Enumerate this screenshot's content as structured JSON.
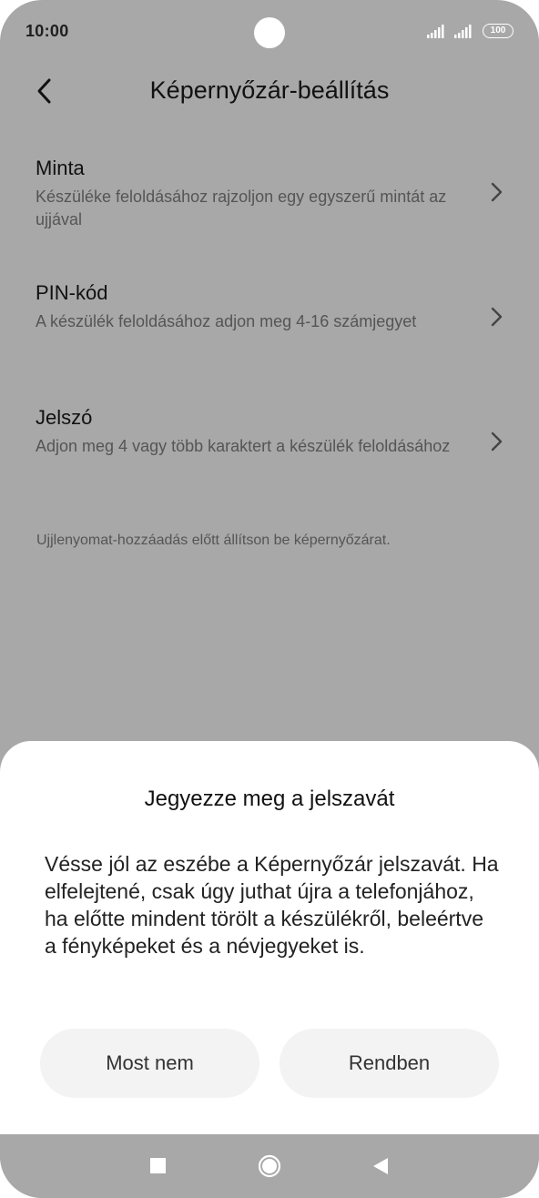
{
  "status_bar": {
    "time": "10:00",
    "battery": "100",
    "icons": [
      "signal-icon",
      "signal-icon",
      "battery-icon"
    ]
  },
  "header": {
    "title": "Képernyőzár-beállítás",
    "back_icon": "chevron-left-icon"
  },
  "options": [
    {
      "title": "Minta",
      "description": "Készüléke feloldásához rajzoljon egy egyszerű mintát az ujjával"
    },
    {
      "title": "PIN-kód",
      "description": "A készülék feloldásához adjon meg 4-16 számjegyet"
    },
    {
      "title": "Jelszó",
      "description": "Adjon meg 4 vagy több karaktert a készülék feloldásához"
    }
  ],
  "hint": "Ujjlenyomat-hozzáadás előtt állítson be képernyőzárat.",
  "dialog": {
    "title": "Jegyezze meg a jelszavát",
    "message": "Vésse jól az eszébe a Képernyőzár jelszavát. Ha elfelejtené, csak úgy juthat újra a telefonjához, ha előtte mindent törölt a készülékről, beleértve a fényképeket és a névjegyeket is.",
    "cancel_label": "Most nem",
    "ok_label": "Rendben"
  },
  "colors": {
    "dim_overlay": "#a8a8a8",
    "sheet_background": "#ffffff",
    "button_background": "#f3f3f3"
  }
}
